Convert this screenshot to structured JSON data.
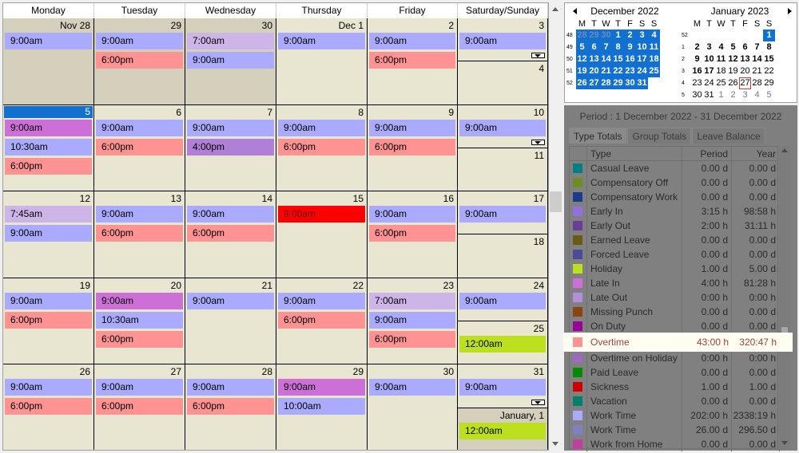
{
  "calendar": {
    "weekday_headers": [
      "Monday",
      "Tuesday",
      "Wednesday",
      "Thursday",
      "Friday",
      "Saturday/Sunday"
    ],
    "weeks": [
      {
        "days": [
          {
            "label": "Nov 28",
            "past": true,
            "events": [
              {
                "time": "9:00am",
                "color": "blue"
              }
            ]
          },
          {
            "label": "29",
            "past": true,
            "events": [
              {
                "time": "9:00am",
                "color": "blue"
              },
              {
                "time": "6:00pm",
                "color": "red"
              }
            ]
          },
          {
            "label": "30",
            "past": true,
            "events": [
              {
                "time": "7:00am",
                "color": "lil"
              },
              {
                "time": "9:00am",
                "color": "blue"
              }
            ]
          },
          {
            "label": "Dec 1",
            "events": [
              {
                "time": "9:00am",
                "color": "blue"
              }
            ]
          },
          {
            "label": "2",
            "events": [
              {
                "time": "9:00am",
                "color": "blue"
              },
              {
                "time": "6:00pm",
                "color": "red"
              }
            ]
          }
        ],
        "weekend": [
          {
            "label": "3",
            "events": [
              {
                "time": "9:00am",
                "color": "blue"
              }
            ],
            "more": true
          },
          {
            "label": "4",
            "events": []
          }
        ]
      },
      {
        "days": [
          {
            "label": "5",
            "today": true,
            "events": [
              {
                "time": "9:00am",
                "color": "vio"
              },
              {
                "time": "10:30am",
                "color": "blue"
              },
              {
                "time": "6:00pm",
                "color": "red"
              }
            ]
          },
          {
            "label": "6",
            "events": [
              {
                "time": "9:00am",
                "color": "blue"
              },
              {
                "time": "6:00pm",
                "color": "red"
              }
            ]
          },
          {
            "label": "7",
            "events": [
              {
                "time": "9:00am",
                "color": "blue"
              },
              {
                "time": "4:00pm",
                "color": "pur"
              }
            ]
          },
          {
            "label": "8",
            "events": [
              {
                "time": "9:00am",
                "color": "blue"
              },
              {
                "time": "6:00pm",
                "color": "red"
              }
            ]
          },
          {
            "label": "9",
            "events": [
              {
                "time": "9:00am",
                "color": "blue"
              },
              {
                "time": "6:00pm",
                "color": "red"
              }
            ]
          }
        ],
        "weekend": [
          {
            "label": "10",
            "events": [
              {
                "time": "9:00am",
                "color": "blue"
              }
            ],
            "more": true
          },
          {
            "label": "11",
            "events": []
          }
        ]
      },
      {
        "days": [
          {
            "label": "12",
            "events": [
              {
                "time": "7:45am",
                "color": "lil"
              },
              {
                "time": "9:00am",
                "color": "blue"
              }
            ]
          },
          {
            "label": "13",
            "events": [
              {
                "time": "9:00am",
                "color": "blue"
              },
              {
                "time": "6:00pm",
                "color": "red"
              }
            ]
          },
          {
            "label": "14",
            "events": [
              {
                "time": "9:00am",
                "color": "blue"
              },
              {
                "time": "6:00pm",
                "color": "red"
              }
            ]
          },
          {
            "label": "15",
            "events": [
              {
                "time": "9:00am",
                "color": "brt"
              }
            ]
          },
          {
            "label": "16",
            "events": [
              {
                "time": "9:00am",
                "color": "blue"
              },
              {
                "time": "6:00pm",
                "color": "red"
              }
            ]
          }
        ],
        "weekend": [
          {
            "label": "17",
            "events": [
              {
                "time": "9:00am",
                "color": "blue"
              }
            ]
          },
          {
            "label": "18",
            "events": []
          }
        ]
      },
      {
        "days": [
          {
            "label": "19",
            "events": [
              {
                "time": "9:00am",
                "color": "blue"
              },
              {
                "time": "6:00pm",
                "color": "red"
              }
            ]
          },
          {
            "label": "20",
            "events": [
              {
                "time": "9:00am",
                "color": "vio"
              },
              {
                "time": "10:30am",
                "color": "blue"
              },
              {
                "time": "6:00pm",
                "color": "red"
              }
            ]
          },
          {
            "label": "21",
            "events": [
              {
                "time": "9:00am",
                "color": "blue"
              }
            ]
          },
          {
            "label": "22",
            "events": [
              {
                "time": "9:00am",
                "color": "blue"
              },
              {
                "time": "6:00pm",
                "color": "red"
              }
            ]
          },
          {
            "label": "23",
            "events": [
              {
                "time": "7:00am",
                "color": "lil"
              },
              {
                "time": "9:00am",
                "color": "blue"
              },
              {
                "time": "6:00pm",
                "color": "red"
              }
            ]
          }
        ],
        "weekend": [
          {
            "label": "24",
            "events": [
              {
                "time": "9:00am",
                "color": "blue"
              }
            ]
          },
          {
            "label": "25",
            "events": [
              {
                "time": "12:00am",
                "color": "grn"
              }
            ]
          }
        ]
      },
      {
        "days": [
          {
            "label": "26",
            "events": [
              {
                "time": "9:00am",
                "color": "blue"
              },
              {
                "time": "6:00pm",
                "color": "red"
              }
            ]
          },
          {
            "label": "27",
            "events": [
              {
                "time": "9:00am",
                "color": "blue"
              },
              {
                "time": "6:00pm",
                "color": "red"
              }
            ]
          },
          {
            "label": "28",
            "events": [
              {
                "time": "9:00am",
                "color": "blue"
              },
              {
                "time": "6:00pm",
                "color": "red"
              }
            ]
          },
          {
            "label": "29",
            "events": [
              {
                "time": "9:00am",
                "color": "vio"
              },
              {
                "time": "10:00am",
                "color": "blue"
              }
            ]
          },
          {
            "label": "30",
            "events": [
              {
                "time": "9:00am",
                "color": "blue"
              }
            ]
          }
        ],
        "weekend": [
          {
            "label": "31",
            "events": [
              {
                "time": "9:00am",
                "color": "blue"
              }
            ],
            "more": true
          },
          {
            "label": "January, 1",
            "past": true,
            "events": [
              {
                "time": "12:00am",
                "color": "grn"
              }
            ]
          }
        ]
      }
    ]
  },
  "mini_calendar": {
    "dow": [
      "M",
      "T",
      "W",
      "T",
      "F",
      "S",
      "S"
    ],
    "months": [
      {
        "title": "December 2022",
        "weeks": [
          {
            "wn": "48",
            "days": [
              [
                "28",
                "selo"
              ],
              [
                "29",
                "selo"
              ],
              [
                "30",
                "selo"
              ],
              [
                "1",
                "sel"
              ],
              [
                "2",
                "sel"
              ],
              [
                "3",
                "sel"
              ],
              [
                "4",
                "sel"
              ]
            ]
          },
          {
            "wn": "49",
            "days": [
              [
                "5",
                "sel"
              ],
              [
                "6",
                "sel"
              ],
              [
                "7",
                "sel"
              ],
              [
                "8",
                "sel"
              ],
              [
                "9",
                "sel"
              ],
              [
                "10",
                "sel"
              ],
              [
                "11",
                "sel"
              ]
            ]
          },
          {
            "wn": "50",
            "days": [
              [
                "12",
                "sel"
              ],
              [
                "13",
                "sel"
              ],
              [
                "14",
                "sel"
              ],
              [
                "15",
                "sel"
              ],
              [
                "16",
                "sel"
              ],
              [
                "17",
                "sel"
              ],
              [
                "18",
                "sel"
              ]
            ]
          },
          {
            "wn": "51",
            "days": [
              [
                "19",
                "sel"
              ],
              [
                "20",
                "sel"
              ],
              [
                "21",
                "sel"
              ],
              [
                "22",
                "sel"
              ],
              [
                "23",
                "sel"
              ],
              [
                "24",
                "sel"
              ],
              [
                "25",
                "sel"
              ]
            ]
          },
          {
            "wn": "52",
            "days": [
              [
                "26",
                "sel"
              ],
              [
                "27",
                "sel"
              ],
              [
                "28",
                "sel"
              ],
              [
                "29",
                "sel"
              ],
              [
                "30",
                "sel"
              ],
              [
                "31",
                "sel"
              ],
              [
                "",
                ""
              ]
            ]
          }
        ]
      },
      {
        "title": "January 2023",
        "weeks": [
          {
            "wn": "52",
            "days": [
              [
                "",
                ""
              ],
              [
                "",
                ""
              ],
              [
                "",
                ""
              ],
              [
                "",
                ""
              ],
              [
                "",
                ""
              ],
              [
                "",
                ""
              ],
              [
                "1",
                "sel"
              ]
            ]
          },
          {
            "wn": "1",
            "days": [
              [
                "2",
                "bold"
              ],
              [
                "3",
                "bold"
              ],
              [
                "4",
                "bold"
              ],
              [
                "5",
                "bold"
              ],
              [
                "6",
                "bold"
              ],
              [
                "7",
                "bold"
              ],
              [
                "8",
                "bold"
              ]
            ]
          },
          {
            "wn": "2",
            "days": [
              [
                "9",
                "bold"
              ],
              [
                "10",
                "bold"
              ],
              [
                "11",
                "bold"
              ],
              [
                "12",
                "bold"
              ],
              [
                "13",
                "bold"
              ],
              [
                "14",
                "bold"
              ],
              [
                "15",
                "bold"
              ]
            ]
          },
          {
            "wn": "3",
            "days": [
              [
                "16",
                "bold"
              ],
              [
                "17",
                "bold"
              ],
              [
                "18",
                ""
              ],
              [
                "19",
                ""
              ],
              [
                "20",
                ""
              ],
              [
                "21",
                ""
              ],
              [
                "22",
                ""
              ]
            ]
          },
          {
            "wn": "4",
            "days": [
              [
                "23",
                ""
              ],
              [
                "24",
                ""
              ],
              [
                "25",
                ""
              ],
              [
                "26",
                ""
              ],
              [
                "27",
                "tdy"
              ],
              [
                "28",
                ""
              ],
              [
                "29",
                ""
              ]
            ]
          },
          {
            "wn": "5",
            "days": [
              [
                "30",
                ""
              ],
              [
                "31",
                ""
              ],
              [
                "1",
                "grey"
              ],
              [
                "2",
                "grey"
              ],
              [
                "3",
                "grey"
              ],
              [
                "4",
                "grey"
              ],
              [
                "5",
                "grey"
              ]
            ]
          }
        ]
      }
    ]
  },
  "panel": {
    "period": "Period : 1 December 2022 - 31 December 2022",
    "tabs": [
      "Type Totals",
      "Group Totals",
      "Leave Balance"
    ],
    "columns": {
      "type": "Type",
      "period": "Period",
      "year": "Year"
    },
    "rows": [
      {
        "name": "Casual Leave",
        "period": "0.00 d",
        "year": "0.00 d",
        "color": "#008080"
      },
      {
        "name": "Compensatory Off",
        "period": "0.00 d",
        "year": "0.00 d",
        "color": "#6b8e23"
      },
      {
        "name": "Compensatory Work",
        "period": "0.00 d",
        "year": "0.00 d",
        "color": "#1e3a8a"
      },
      {
        "name": "Early In",
        "period": "3:15 h",
        "year": "98:58 h",
        "color": "#9370db"
      },
      {
        "name": "Early Out",
        "period": "2:00 h",
        "year": "31:11 h",
        "color": "#6a3d9a"
      },
      {
        "name": "Earned Leave",
        "period": "0.00 d",
        "year": "0.00 d",
        "color": "#6b5a14"
      },
      {
        "name": "Forced Leave",
        "period": "0.00 d",
        "year": "0.00 d",
        "color": "#4b4b9b"
      },
      {
        "name": "Holiday",
        "period": "1.00 d",
        "year": "5.00 d",
        "color": "#bce01e"
      },
      {
        "name": "Late In",
        "period": "4:00 h",
        "year": "81:28 h",
        "color": "#cc70d8"
      },
      {
        "name": "Late Out",
        "period": "0:00 h",
        "year": "0:00 h",
        "color": "#b090d8"
      },
      {
        "name": "Missing Punch",
        "period": "0.00 d",
        "year": "0.00 d",
        "color": "#8b4513"
      },
      {
        "name": "On Duty",
        "period": "0.00 d",
        "year": "0.00 d",
        "color": "#9b009b"
      },
      {
        "name": "Overtime",
        "period": "43:00 h",
        "year": "320:47 h",
        "color": "#ff9292",
        "highlight": true
      },
      {
        "name": "Overtime on Holiday",
        "period": "0:00 h",
        "year": "0:00 h",
        "color": "#9b6bbf"
      },
      {
        "name": "Paid Leave",
        "period": "0.00 d",
        "year": "0.00 d",
        "color": "#008b00"
      },
      {
        "name": "Sickness",
        "period": "1.00 d",
        "year": "1.00 d",
        "color": "#d00000"
      },
      {
        "name": "Vacation",
        "period": "0.00 d",
        "year": "0.00 d",
        "color": "#00806a"
      },
      {
        "name": "Work Time",
        "period": "202:00 h",
        "year": "2338:19 h",
        "color": "#aaaaff"
      },
      {
        "name": "Work Time",
        "period": "26.00 d",
        "year": "296.50 d",
        "color": "#8080c0"
      },
      {
        "name": "Work from Home",
        "period": "0.00 d",
        "year": "0.00 d",
        "color": "#c040a0"
      }
    ]
  },
  "icons": {
    "scroll_up": "chevron-up-icon",
    "scroll_down": "chevron-down-icon",
    "prev_month": "chevron-left-icon",
    "next_month": "chevron-right-icon",
    "more": "more-events-icon"
  }
}
